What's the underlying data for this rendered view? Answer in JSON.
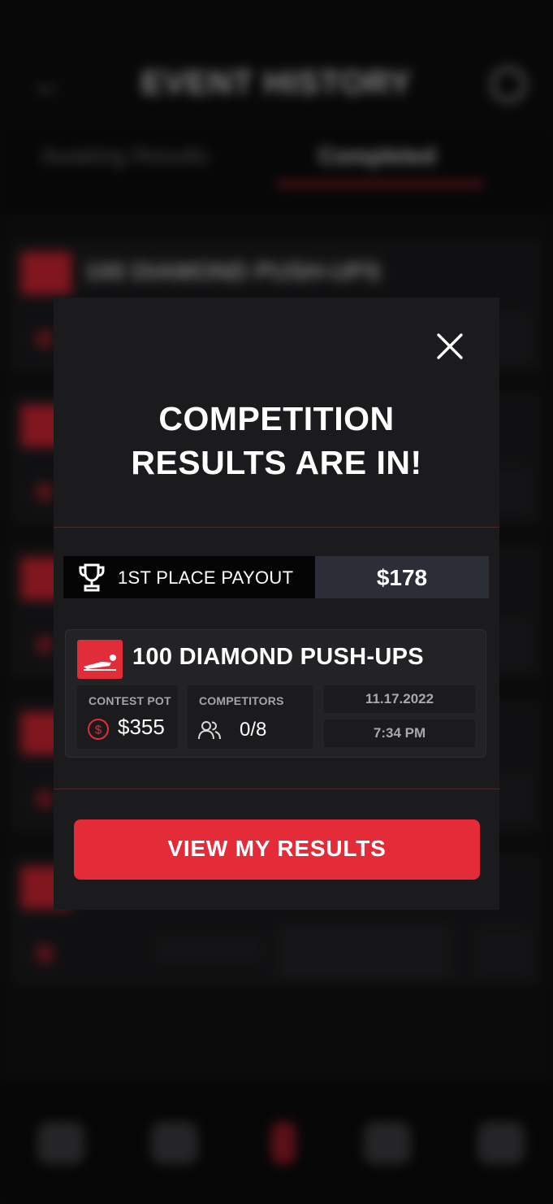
{
  "background": {
    "title": "EVENT HISTORY",
    "tabs": [
      "Awaiting Results",
      "Completed"
    ],
    "active_tab": "Completed",
    "first_event_title": "100 DIAMOND PUSH-UPS"
  },
  "modal": {
    "title_line1": "COMPETITION",
    "title_line2": "RESULTS ARE IN!",
    "payout_label": "1ST PLACE PAYOUT",
    "payout_value": "$178",
    "event": {
      "title": "100 DIAMOND PUSH-UPS",
      "contest_pot_label": "CONTEST POT",
      "contest_pot_value": "$355",
      "competitors_label": "COMPETITORS",
      "competitors_value": "0/8",
      "date": "11.17.2022",
      "time": "7:34 PM"
    },
    "cta_label": "VIEW MY RESULTS",
    "icons": {
      "close": "close-icon",
      "trophy": "trophy-icon",
      "badge": "pushup-icon",
      "pot": "dollar-circle-icon",
      "competitors": "people-icon"
    }
  },
  "colors": {
    "accent_red": "#e42b38",
    "modal_bg": "#1b1b1d",
    "payout_value_bg": "#2b2e36"
  }
}
